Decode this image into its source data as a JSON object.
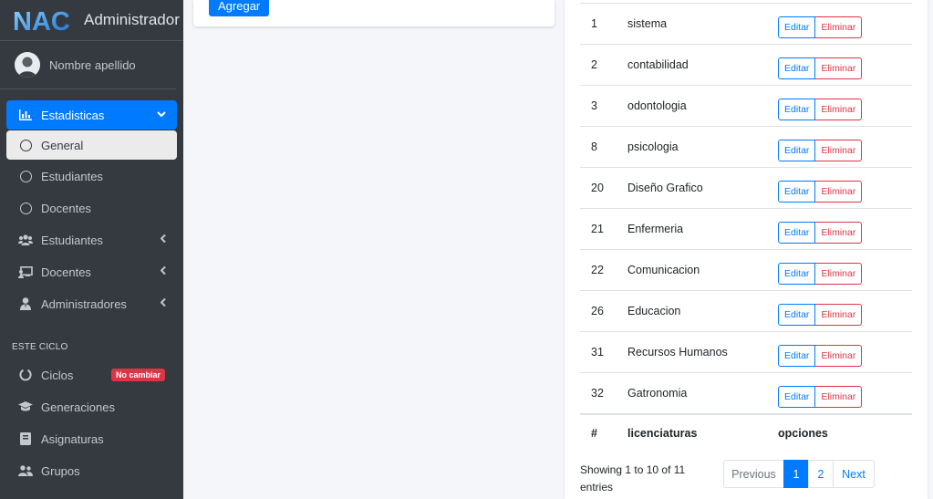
{
  "brand": {
    "title": "Administrador",
    "logo_text": "NAC"
  },
  "user": {
    "name": "Nombre apellido"
  },
  "sidebar": {
    "items": [
      {
        "label": "Estadisticas",
        "icon": "chart-bar-icon",
        "state": "active",
        "caret": "chevron-down"
      },
      {
        "label": "General",
        "icon": "circle-icon",
        "state": "sub-active"
      },
      {
        "label": "Estudiantes",
        "icon": "circle-icon",
        "state": ""
      },
      {
        "label": "Docentes",
        "icon": "circle-icon",
        "state": ""
      },
      {
        "label": "Estudiantes",
        "icon": "users-icon",
        "state": "",
        "caret": "chevron-left"
      },
      {
        "label": "Docentes",
        "icon": "chalkboard-teacher-icon",
        "state": "",
        "caret": "chevron-left"
      },
      {
        "label": "Administradores",
        "icon": "user-tie-icon",
        "state": "",
        "caret": "chevron-left"
      }
    ],
    "section_header": "ESTE CICLO",
    "cycle_items": [
      {
        "label": "Ciclos",
        "icon": "circle-notch-icon",
        "badge": "No cambiar"
      },
      {
        "label": "Generaciones",
        "icon": "graduation-cap-icon"
      },
      {
        "label": "Asignaturas",
        "icon": "book-icon"
      },
      {
        "label": "Grupos",
        "icon": "user-friends-icon"
      }
    ]
  },
  "form_card": {
    "add_button": "Agregar"
  },
  "table": {
    "rows": [
      {
        "id": "1",
        "name": "sistema"
      },
      {
        "id": "2",
        "name": "contabilidad"
      },
      {
        "id": "3",
        "name": "odontologia"
      },
      {
        "id": "8",
        "name": "psicologia"
      },
      {
        "id": "20",
        "name": "Diseño Grafico"
      },
      {
        "id": "21",
        "name": "Enfermeria"
      },
      {
        "id": "22",
        "name": "Comunicacion"
      },
      {
        "id": "26",
        "name": "Educacion"
      },
      {
        "id": "31",
        "name": "Recursos Humanos"
      },
      {
        "id": "32",
        "name": "Gatronomia"
      }
    ],
    "edit_label": "Editar",
    "delete_label": "Eliminar",
    "footer_headers": {
      "id": "#",
      "name": "licenciaturas",
      "options": "opciones"
    }
  },
  "pagination": {
    "info": "Showing 1 to 10 of 11 entries",
    "previous": "Previous",
    "pages": [
      "1",
      "2"
    ],
    "current": "1",
    "next": "Next"
  },
  "colors": {
    "primary": "#007bff",
    "danger": "#dc3545",
    "sidebar_bg": "#343a40"
  }
}
